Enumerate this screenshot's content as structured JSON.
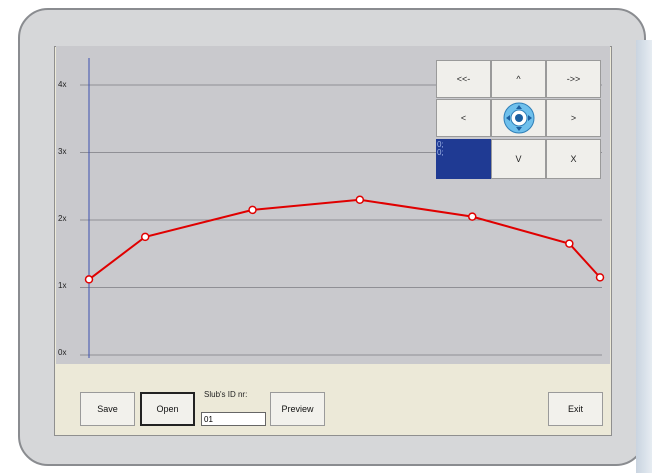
{
  "window": {
    "background": "#ece9d8",
    "plot_background": "#c9c9cd"
  },
  "pad": {
    "rewind_label": "<<-",
    "up_label": "^",
    "forward_label": "->>",
    "left_label": "<",
    "right_label": ">",
    "down_label": "V",
    "close_label": "X",
    "readout_line1": "0;",
    "readout_line2": "0;",
    "center_icon": "move-joystick-icon"
  },
  "toolbar": {
    "save_label": "Save",
    "open_label": "Open",
    "slub_label": "Slub's ID nr:",
    "slub_value": "01",
    "preview_label": "Preview",
    "exit_label": "Exit"
  },
  "chart_data": {
    "type": "line",
    "yticks": [
      "0x",
      "1x",
      "2x",
      "3x",
      "4x"
    ],
    "ylim": [
      0,
      4.4
    ],
    "xlim": [
      0,
      1
    ],
    "grid": true,
    "line_color": "#e00000",
    "series": [
      {
        "x": [
          0,
          0.11,
          0.32,
          0.53,
          0.75,
          0.94,
          1.0
        ],
        "y": [
          1.12,
          1.75,
          2.15,
          2.3,
          2.05,
          1.65,
          1.15
        ]
      }
    ]
  }
}
